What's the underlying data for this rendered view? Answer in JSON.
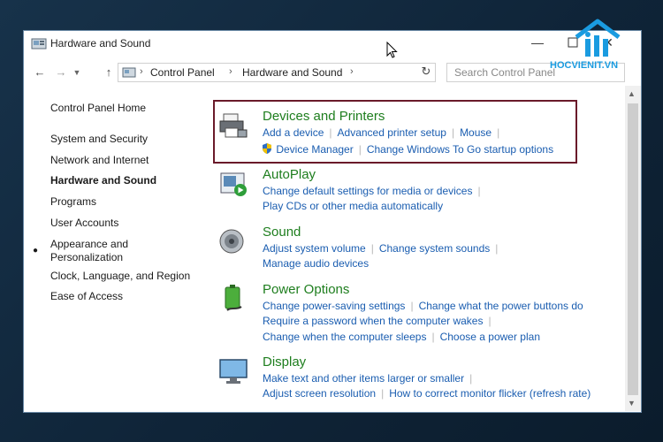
{
  "window": {
    "title": "Hardware and Sound",
    "minimize_symbol": "—",
    "close_symbol": "✕"
  },
  "address": {
    "crumbs": [
      "Control Panel",
      "Hardware and Sound"
    ],
    "separator": "›",
    "search_placeholder": "Search Control Panel"
  },
  "sidebar": {
    "items": [
      {
        "label": "Control Panel Home"
      },
      {
        "label": "System and Security"
      },
      {
        "label": "Network and Internet"
      },
      {
        "label": "Hardware and Sound",
        "active": true
      },
      {
        "label": "Programs"
      },
      {
        "label": "User Accounts"
      },
      {
        "label": "Appearance and\nPersonalization"
      },
      {
        "label": "Clock, Language, and Region"
      },
      {
        "label": "Ease of Access"
      }
    ]
  },
  "categories": [
    {
      "title": "Devices and Printers",
      "icon": "printer-icon",
      "lines": [
        [
          "Add a device",
          "Advanced printer setup",
          "Mouse"
        ],
        [
          "Device Manager",
          "Change Windows To Go startup options"
        ]
      ]
    },
    {
      "title": "AutoPlay",
      "icon": "autoplay-icon",
      "lines": [
        [
          "Change default settings for media or devices"
        ],
        [
          "Play CDs or other media automatically"
        ]
      ]
    },
    {
      "title": "Sound",
      "icon": "speaker-icon",
      "lines": [
        [
          "Adjust system volume",
          "Change system sounds"
        ],
        [
          "Manage audio devices"
        ]
      ]
    },
    {
      "title": "Power Options",
      "icon": "battery-icon",
      "lines": [
        [
          "Change power-saving settings",
          "Change what the power buttons do"
        ],
        [
          "Require a password when the computer wakes"
        ],
        [
          "Change when the computer sleeps",
          "Choose a power plan"
        ]
      ]
    },
    {
      "title": "Display",
      "icon": "monitor-icon",
      "lines": [
        [
          "Make text and other items larger or smaller"
        ],
        [
          "Adjust screen resolution",
          "How to correct monitor flicker (refresh rate)"
        ]
      ]
    }
  ],
  "watermark": {
    "text": "HOCVIENIT.VN",
    "color": "#1a9be0"
  },
  "colors": {
    "heading_green": "#1e7e1e",
    "link_blue": "#1a5db0",
    "highlight_border": "#6a1a2a"
  }
}
